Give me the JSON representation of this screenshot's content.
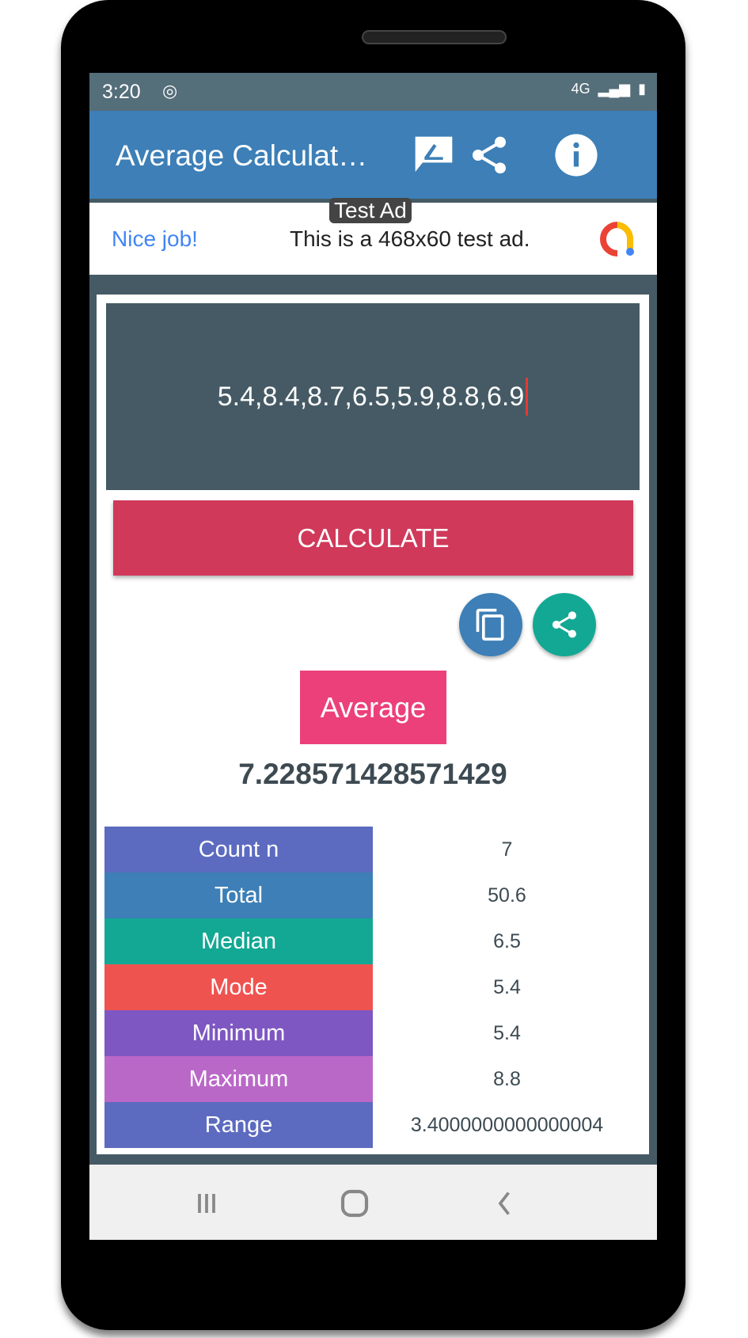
{
  "status": {
    "time": "3:20",
    "network": "4G"
  },
  "appbar": {
    "title": "Average Calculat…",
    "icons": [
      "feedback-icon",
      "share-icon",
      "info-icon"
    ]
  },
  "ad": {
    "badge": "Test Ad",
    "headline": "Nice job!",
    "message": "This is a 468x60 test ad."
  },
  "input": {
    "value": "5.4,8.4,8.7,6.5,5.9,8.8,6.9"
  },
  "calculate_label": "CALCULATE",
  "result": {
    "label": "Average",
    "value": "7.228571428571429"
  },
  "stats": [
    {
      "label": "Count n",
      "value": "7",
      "color": "#5c6bc0"
    },
    {
      "label": "Total",
      "value": "50.6",
      "color": "#3d7fb6"
    },
    {
      "label": "Median",
      "value": "6.5",
      "color": "#13a894"
    },
    {
      "label": "Mode",
      "value": "5.4",
      "color": "#ef5350"
    },
    {
      "label": "Minimum",
      "value": "5.4",
      "color": "#7e57c2"
    },
    {
      "label": "Maximum",
      "value": "8.8",
      "color": "#ba68c8"
    },
    {
      "label": "Range",
      "value": "3.4000000000000004",
      "color": "#5c6bc0"
    }
  ],
  "colors": {
    "appbar": "#3d7fb6",
    "calculate": "#d0395a",
    "average": "#ec407a",
    "copy_fab": "#3d7fb6",
    "share_fab": "#13a894"
  }
}
